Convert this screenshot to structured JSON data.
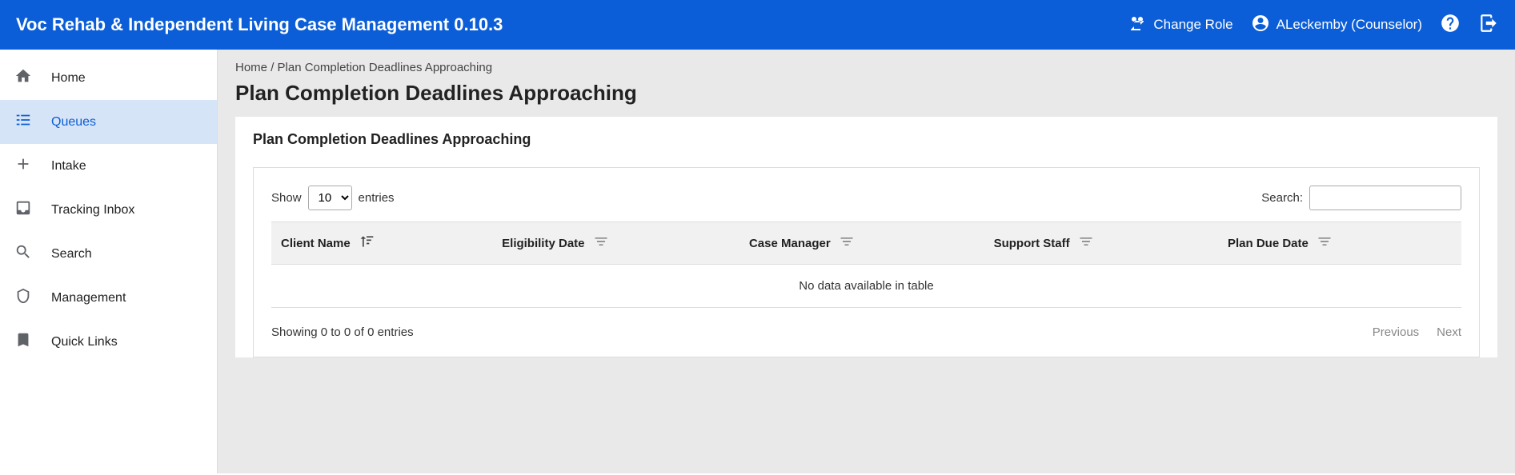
{
  "header": {
    "app_title": "Voc Rehab & Independent Living Case Management 0.10.3",
    "change_role_label": "Change Role",
    "user_label": "ALeckemby (Counselor)"
  },
  "sidebar": {
    "items": [
      {
        "label": "Home"
      },
      {
        "label": "Queues"
      },
      {
        "label": "Intake"
      },
      {
        "label": "Tracking Inbox"
      },
      {
        "label": "Search"
      },
      {
        "label": "Management"
      },
      {
        "label": "Quick Links"
      }
    ]
  },
  "breadcrumb": {
    "home": "Home",
    "sep": "/",
    "current": "Plan Completion Deadlines Approaching"
  },
  "page_title": "Plan Completion Deadlines Approaching",
  "panel": {
    "title": "Plan Completion Deadlines Approaching",
    "show_label": "Show",
    "entries_label": "entries",
    "entries_value": "10",
    "search_label": "Search:",
    "columns": [
      "Client Name",
      "Eligibility Date",
      "Case Manager",
      "Support Staff",
      "Plan Due Date"
    ],
    "no_data": "No data available in table",
    "showing_info": "Showing 0 to 0 of 0 entries",
    "prev_label": "Previous",
    "next_label": "Next"
  }
}
